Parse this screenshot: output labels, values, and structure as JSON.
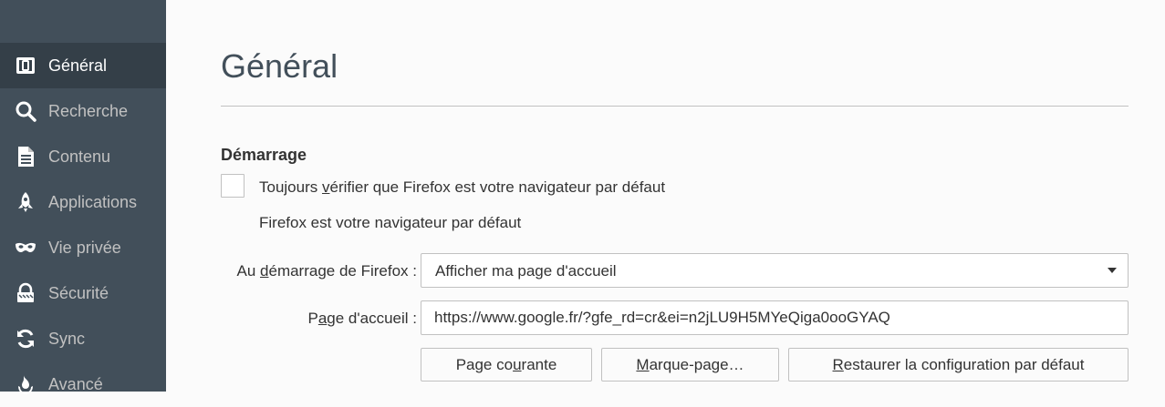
{
  "sidebar": {
    "items": [
      {
        "label": "Général",
        "icon": "general-icon"
      },
      {
        "label": "Recherche",
        "icon": "search-icon"
      },
      {
        "label": "Contenu",
        "icon": "content-icon"
      },
      {
        "label": "Applications",
        "icon": "applications-icon"
      },
      {
        "label": "Vie privée",
        "icon": "privacy-mask-icon"
      },
      {
        "label": "Sécurité",
        "icon": "lock-icon"
      },
      {
        "label": "Sync",
        "icon": "sync-icon"
      },
      {
        "label": "Avancé",
        "icon": "advanced-icon"
      }
    ],
    "selected": "Général"
  },
  "main": {
    "title": "Général",
    "startup": {
      "heading": "Démarrage",
      "default_check": {
        "pre": "Toujours ",
        "accel": "v",
        "post": "érifier que Firefox est votre navigateur par défaut",
        "checked": false
      },
      "default_status": "Firefox est votre navigateur par défaut",
      "on_start": {
        "label_pre": "Au ",
        "label_accel": "d",
        "label_post": "émarrage de Firefox :",
        "selected": "Afficher ma page d'accueil"
      },
      "homepage": {
        "label_pre": "P",
        "label_accel": "a",
        "label_post": "ge d'accueil :",
        "value": "https://www.google.fr/?gfe_rd=cr&ei=n2jLU9H5MYeQiga0ooGYAQ"
      },
      "buttons": {
        "current": {
          "pre": "Page co",
          "accel": "u",
          "post": "rante"
        },
        "bookmark": {
          "pre": "",
          "accel": "M",
          "post": "arque-page…"
        },
        "restore": {
          "pre": "",
          "accel": "R",
          "post": "estaurer la configuration par défaut"
        }
      }
    }
  },
  "colors": {
    "sidebar_bg": "#424f5a",
    "sidebar_selected_bg": "#343f48",
    "page_bg": "#fbfbfb",
    "title": "#424f5a"
  }
}
